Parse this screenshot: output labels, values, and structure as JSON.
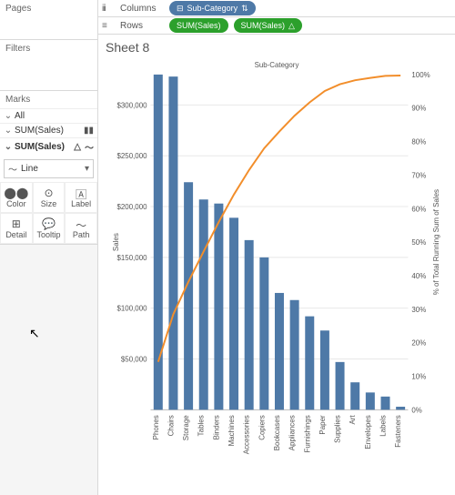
{
  "panels": {
    "pages": "Pages",
    "filters": "Filters",
    "marks": "Marks",
    "all": "All",
    "sum1": "SUM(Sales)",
    "sum2": "SUM(Sales)",
    "lineSelect": "Line",
    "buttons": {
      "color": "Color",
      "size": "Size",
      "label": "Label",
      "detail": "Detail",
      "tooltip": "Tooltip",
      "path": "Path"
    }
  },
  "shelves": {
    "columnsLabel": "Columns",
    "rowsLabel": "Rows",
    "colPill": "Sub-Category",
    "rowPill1": "SUM(Sales)",
    "rowPill2": "SUM(Sales)"
  },
  "sheet": {
    "title": "Sheet 8"
  },
  "chart_data": {
    "type": "bar",
    "title": "Sub-Category",
    "ylabel": "Sales",
    "y2label": "% of Total Running Sum of Sales",
    "ylim": [
      0,
      330000
    ],
    "y2lim": [
      0,
      100
    ],
    "yticks": [
      50000,
      100000,
      150000,
      200000,
      250000,
      300000
    ],
    "yticklabels": [
      "$50,000",
      "$100,000",
      "$150,000",
      "$200,000",
      "$250,000",
      "$300,000"
    ],
    "y2ticks": [
      0,
      10,
      20,
      30,
      40,
      50,
      60,
      70,
      80,
      90,
      100
    ],
    "y2ticklabels": [
      "0%",
      "10%",
      "20%",
      "30%",
      "40%",
      "50%",
      "60%",
      "70%",
      "80%",
      "90%",
      "100%"
    ],
    "categories": [
      "Phones",
      "Chairs",
      "Storage",
      "Tables",
      "Binders",
      "Machines",
      "Accessories",
      "Copiers",
      "Bookcases",
      "Appliances",
      "Furnishings",
      "Paper",
      "Supplies",
      "Art",
      "Envelopes",
      "Labels",
      "Fasteners"
    ],
    "values": [
      330000,
      328000,
      224000,
      207000,
      203000,
      189000,
      167000,
      150000,
      115000,
      108000,
      92000,
      78000,
      47000,
      27000,
      17000,
      13000,
      3000
    ],
    "cumulative_pct": [
      14.3,
      28.5,
      38.2,
      47.2,
      56.0,
      64.2,
      71.5,
      78.0,
      83.0,
      87.7,
      91.7,
      95.1,
      97.1,
      98.3,
      99.0,
      99.6,
      99.7
    ]
  }
}
